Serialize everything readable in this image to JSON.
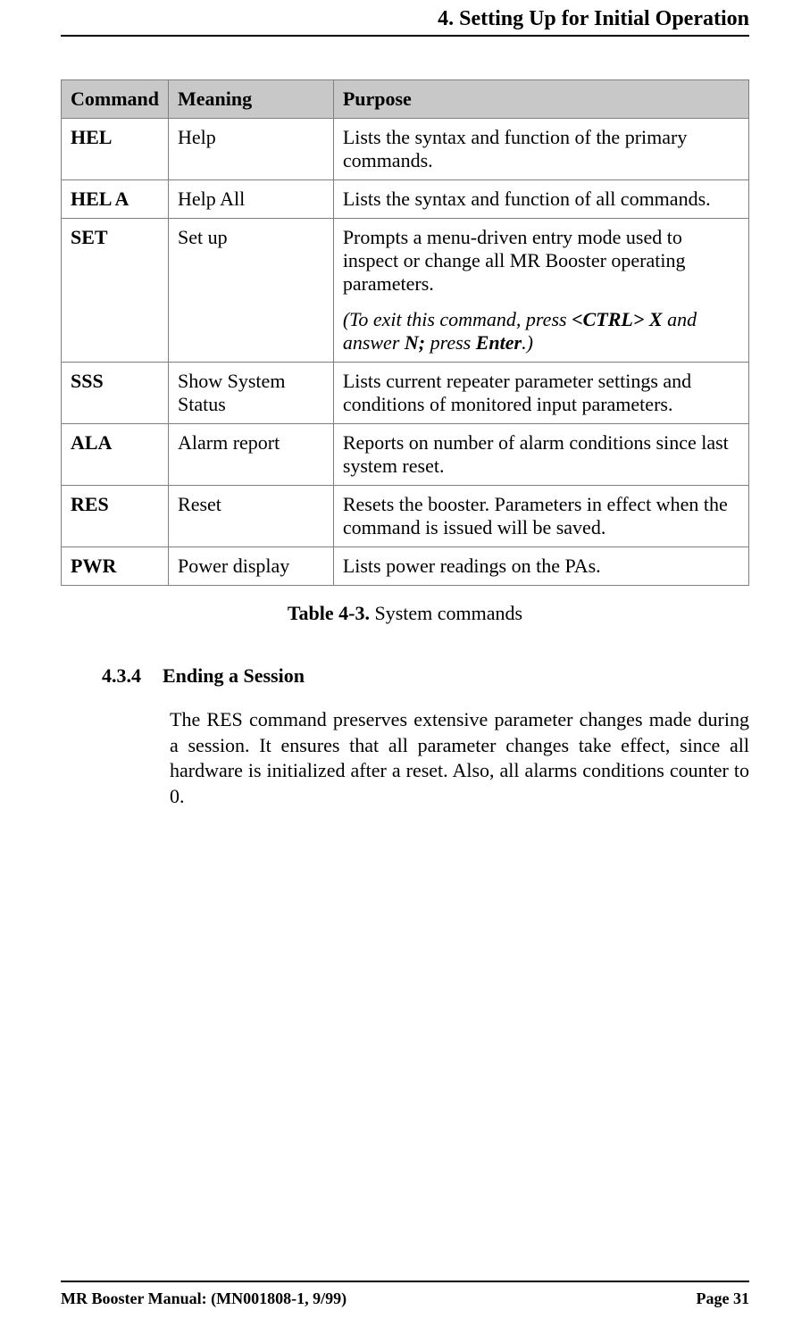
{
  "header": {
    "title": "4. Setting Up for Initial Operation"
  },
  "table": {
    "headers": {
      "command": "Command",
      "meaning": "Meaning",
      "purpose": "Purpose"
    },
    "rows": [
      {
        "command": "HEL",
        "meaning": "Help",
        "purpose": "Lists the syntax and function of the primary commands."
      },
      {
        "command": "HEL A",
        "meaning": "Help All",
        "purpose": "Lists the syntax and function of all commands."
      },
      {
        "command": "SET",
        "meaning": "Set up",
        "purpose": "Prompts a menu-driven entry mode used to inspect or change all MR Booster operating parameters.",
        "note": {
          "pre": "(To exit this command, press ",
          "ctrl": "<CTRL> X",
          "mid": " and answer ",
          "n": "N;",
          "mid2": " press ",
          "enter": "Enter",
          "post": ".)"
        }
      },
      {
        "command": "SSS",
        "meaning": "Show System Status",
        "purpose": "Lists current repeater parameter settings and conditions of monitored input parameters."
      },
      {
        "command": "ALA",
        "meaning": "Alarm report",
        "purpose": "Reports on number of alarm conditions since last system reset."
      },
      {
        "command": "RES",
        "meaning": "Reset",
        "purpose": "Resets the booster. Parameters in effect when the command is issued will be saved."
      },
      {
        "command": "PWR",
        "meaning": "Power display",
        "purpose": "Lists power readings on the PAs."
      }
    ]
  },
  "caption": {
    "label": "Table 4-3.",
    "text": " System commands"
  },
  "section": {
    "number": "4.3.4",
    "title": "Ending a Session",
    "body": "The RES command preserves extensive parameter changes made during a session. It ensures that all parameter changes take effect, since all hardware is initialized after a reset. Also, all alarms conditions counter to 0."
  },
  "footer": {
    "left": "MR Booster Manual: (MN001808-1, 9/99)",
    "right": "Page 31"
  }
}
